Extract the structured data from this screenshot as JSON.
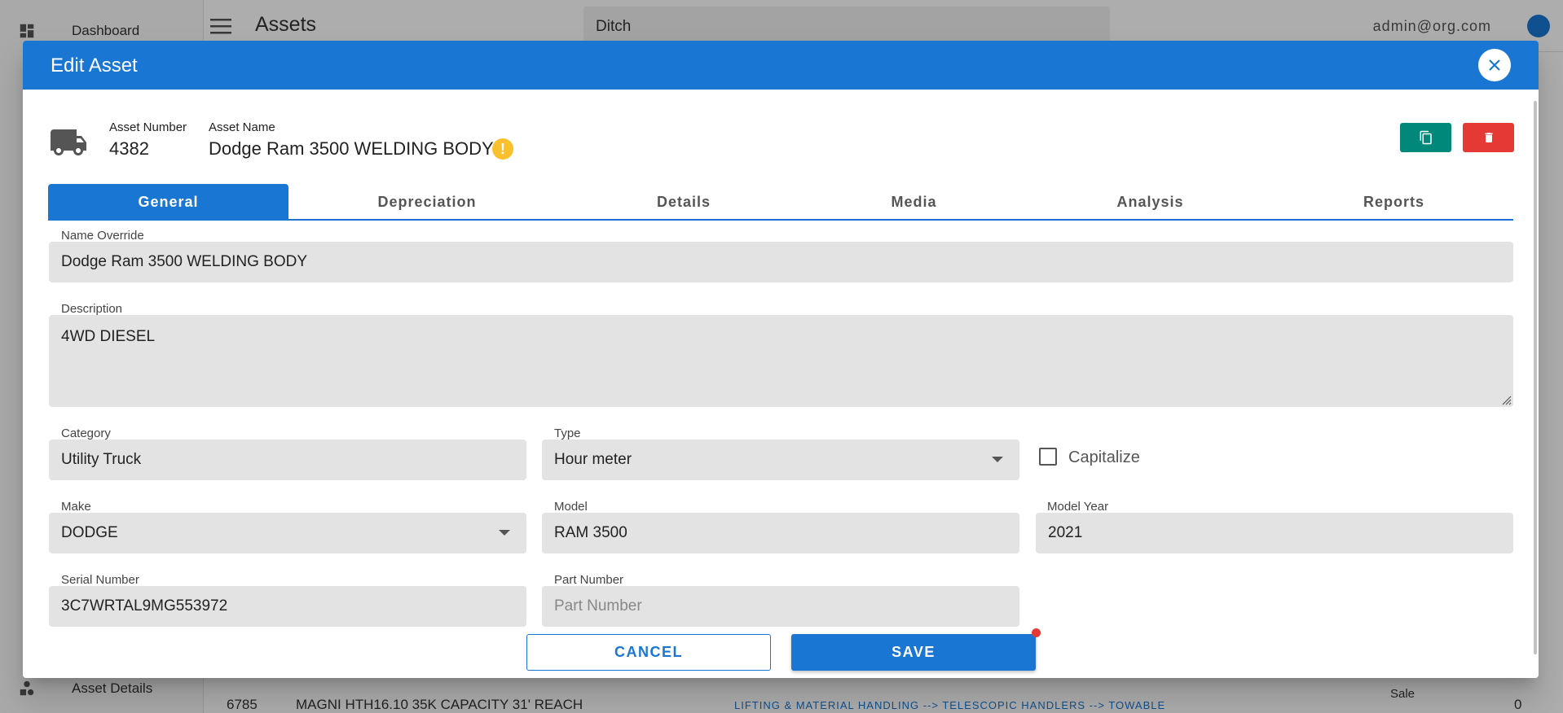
{
  "app": {
    "sidebar": {
      "items": [
        {
          "label": "Dashboard",
          "icon": "dashboard-icon"
        },
        {
          "label": "Asset Details",
          "icon": "shapes-icon"
        }
      ]
    },
    "header": {
      "title": "Assets",
      "search_value": "Ditch",
      "user": "admin@org.com"
    },
    "background_row": {
      "number": "6785",
      "name": "MAGNI HTH16.10 35K CAPACITY 31' REACH",
      "category_path": "LIFTING & MATERIAL HANDLING --> TELESCOPIC HANDLERS --> TOWABLE",
      "status": "Sale",
      "count": "0"
    }
  },
  "dialog": {
    "title": "Edit Asset",
    "asset_number_label": "Asset Number",
    "asset_number": "4382",
    "asset_name_label": "Asset Name",
    "asset_name": "Dodge Ram 3500 WELDING BODY",
    "tabs": [
      "General",
      "Depreciation",
      "Details",
      "Media",
      "Analysis",
      "Reports"
    ],
    "active_tab": "General",
    "fields": {
      "name_override": {
        "label": "Name Override",
        "value": "Dodge Ram 3500 WELDING BODY"
      },
      "description": {
        "label": "Description",
        "value": "4WD DIESEL"
      },
      "category": {
        "label": "Category",
        "value": "Utility Truck"
      },
      "type": {
        "label": "Type",
        "value": "Hour meter"
      },
      "capitalize": {
        "label": "Capitalize",
        "checked": false
      },
      "make": {
        "label": "Make",
        "value": "DODGE"
      },
      "model": {
        "label": "Model",
        "value": "RAM 3500"
      },
      "model_year": {
        "label": "Model Year",
        "value": "2021"
      },
      "serial_number": {
        "label": "Serial Number",
        "value": "3C7WRTAL9MG553972"
      },
      "part_number": {
        "label": "Part Number",
        "value": "",
        "placeholder": "Part Number"
      }
    },
    "buttons": {
      "cancel": "CANCEL",
      "save": "SAVE"
    }
  },
  "colors": {
    "primary": "#1976d2",
    "copy_button": "#00897b",
    "delete_button": "#e53935",
    "warning": "#fbc02d"
  }
}
